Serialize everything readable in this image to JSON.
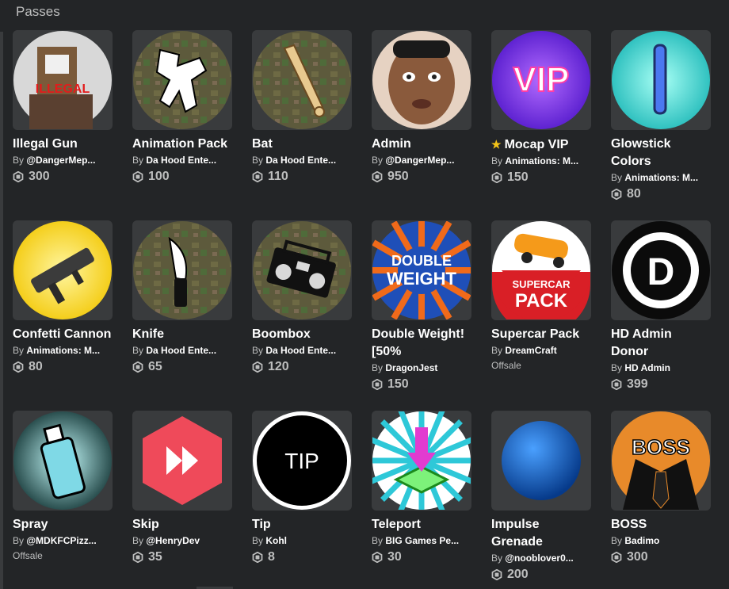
{
  "section": {
    "title": "Passes"
  },
  "labels": {
    "by": "By",
    "offsale": "Offsale"
  },
  "passes": [
    {
      "name": "Illegal Gun",
      "creator": "@DangerMep...",
      "price": "300",
      "icon": "illegal-gun-thumbnail"
    },
    {
      "name": "Animation Pack",
      "creator": "Da Hood Ente...",
      "price": "100",
      "icon": "animation-pack-thumbnail"
    },
    {
      "name": "Bat",
      "creator": "Da Hood Ente...",
      "price": "110",
      "icon": "bat-thumbnail"
    },
    {
      "name": "Admin",
      "creator": "@DangerMep...",
      "price": "950",
      "icon": "admin-face-thumbnail"
    },
    {
      "name": "Mocap VIP",
      "creator": "Animations: M...",
      "price": "150",
      "icon": "vip-thumbnail",
      "starred": true
    },
    {
      "name": "Glowstick Colors",
      "creator": "Animations: M...",
      "price": "80",
      "icon": "glowstick-thumbnail"
    },
    {
      "name": "Confetti Cannon",
      "creator": "Animations: M...",
      "price": "80",
      "icon": "confetti-cannon-thumbnail"
    },
    {
      "name": "Knife",
      "creator": "Da Hood Ente...",
      "price": "65",
      "icon": "knife-thumbnail"
    },
    {
      "name": "Boombox",
      "creator": "Da Hood Ente...",
      "price": "120",
      "icon": "boombox-thumbnail"
    },
    {
      "name": "Double Weight! [50%",
      "creator": "DragonJest",
      "price": "150",
      "icon": "double-weight-thumbnail"
    },
    {
      "name": "Supercar Pack",
      "creator": "DreamCraft",
      "price": null,
      "offsale": true,
      "icon": "supercar-pack-thumbnail"
    },
    {
      "name": "HD Admin Donor",
      "creator": "HD Admin",
      "price": "399",
      "icon": "hd-admin-thumbnail"
    },
    {
      "name": "Spray",
      "creator": "@MDKFCPizz...",
      "price": null,
      "offsale": true,
      "icon": "spray-can-thumbnail"
    },
    {
      "name": "Skip",
      "creator": "@HenryDev",
      "price": "35",
      "icon": "skip-thumbnail"
    },
    {
      "name": "Tip",
      "creator": "Kohl",
      "price": "8",
      "icon": "tip-thumbnail",
      "thumb_text": "TIP"
    },
    {
      "name": "Teleport",
      "creator": "BIG Games Pe...",
      "price": "30",
      "icon": "teleport-thumbnail"
    },
    {
      "name": "Impulse Grenade",
      "creator": "@nooblover0...",
      "price": "200",
      "icon": "impulse-grenade-thumbnail"
    },
    {
      "name": "BOSS",
      "creator": "Badimo",
      "price": "300",
      "icon": "boss-thumbnail"
    }
  ],
  "thumb_text": {
    "illegal": "ILLEGAL",
    "vip": "VIP",
    "double1": "DOUBLE",
    "double2": "WEIGHT",
    "supercar1": "SUPERCAR",
    "supercar2": "PACK",
    "hd": "D",
    "tip": "TIP",
    "boss": "BOSS"
  },
  "colors": {
    "background": "#232527",
    "tile": "#393b3d",
    "muted": "#bdbebe",
    "star": "#f5c518"
  }
}
